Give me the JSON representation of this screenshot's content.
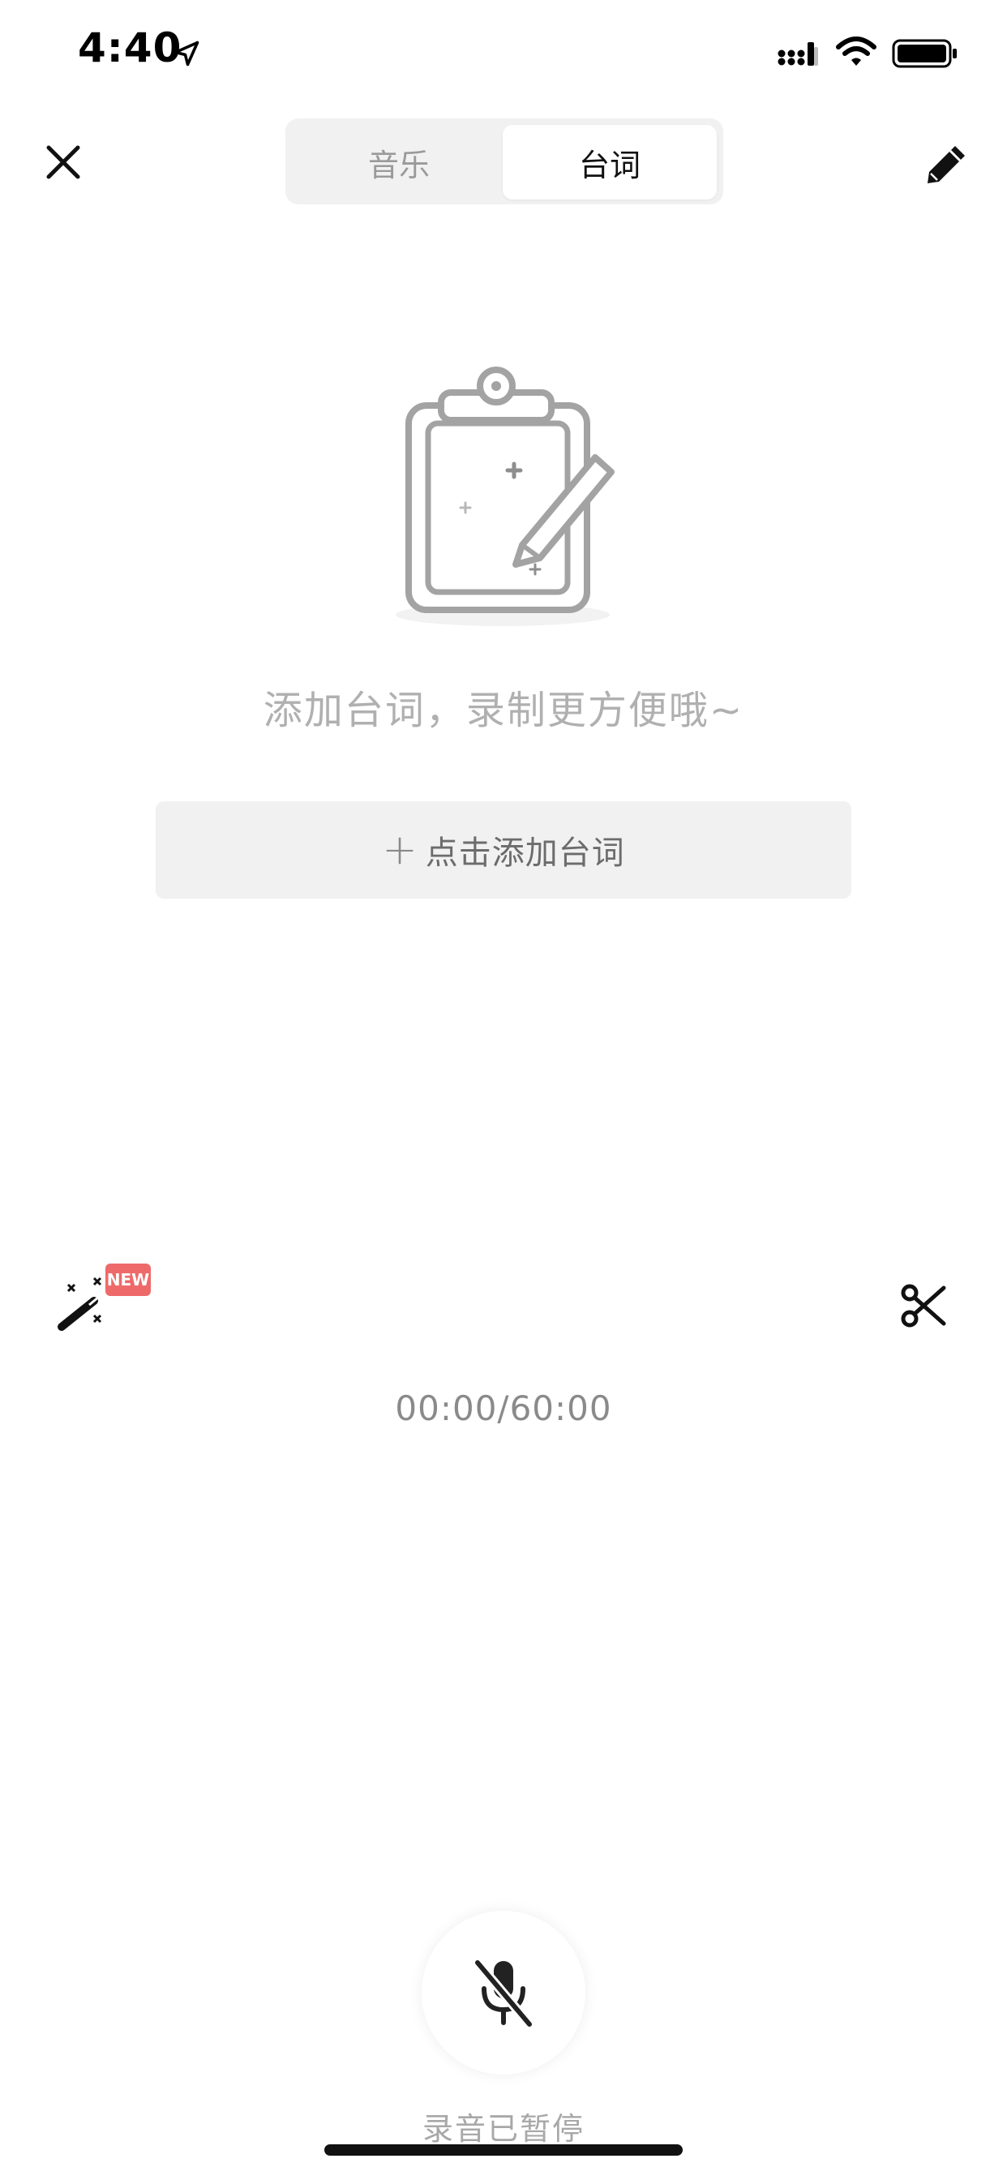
{
  "status_bar": {
    "time": "4:40",
    "icons": [
      "location-arrow-icon",
      "signal-icon",
      "wifi-icon",
      "battery-icon"
    ]
  },
  "header": {
    "close_icon": "close-icon",
    "tabs": [
      {
        "label": "音乐",
        "selected": false
      },
      {
        "label": "台词",
        "selected": true
      }
    ],
    "edit_icon": "pencil-icon"
  },
  "empty_state": {
    "illustration": "clipboard-pen-icon",
    "message": "添加台词，录制更方便哦~",
    "add_button_label": "点击添加台词"
  },
  "tools": {
    "magic_icon": "magic-wand-icon",
    "badge": "NEW",
    "scissors_icon": "scissors-icon"
  },
  "timer": "00:00/60:00",
  "recorder": {
    "mic_icon": "mic-muted-icon",
    "status": "录音已暂停"
  },
  "colors": {
    "badge": "#ee6a6a",
    "segment_bg": "#f1f1f1",
    "muted_text": "#b0b0b0"
  }
}
